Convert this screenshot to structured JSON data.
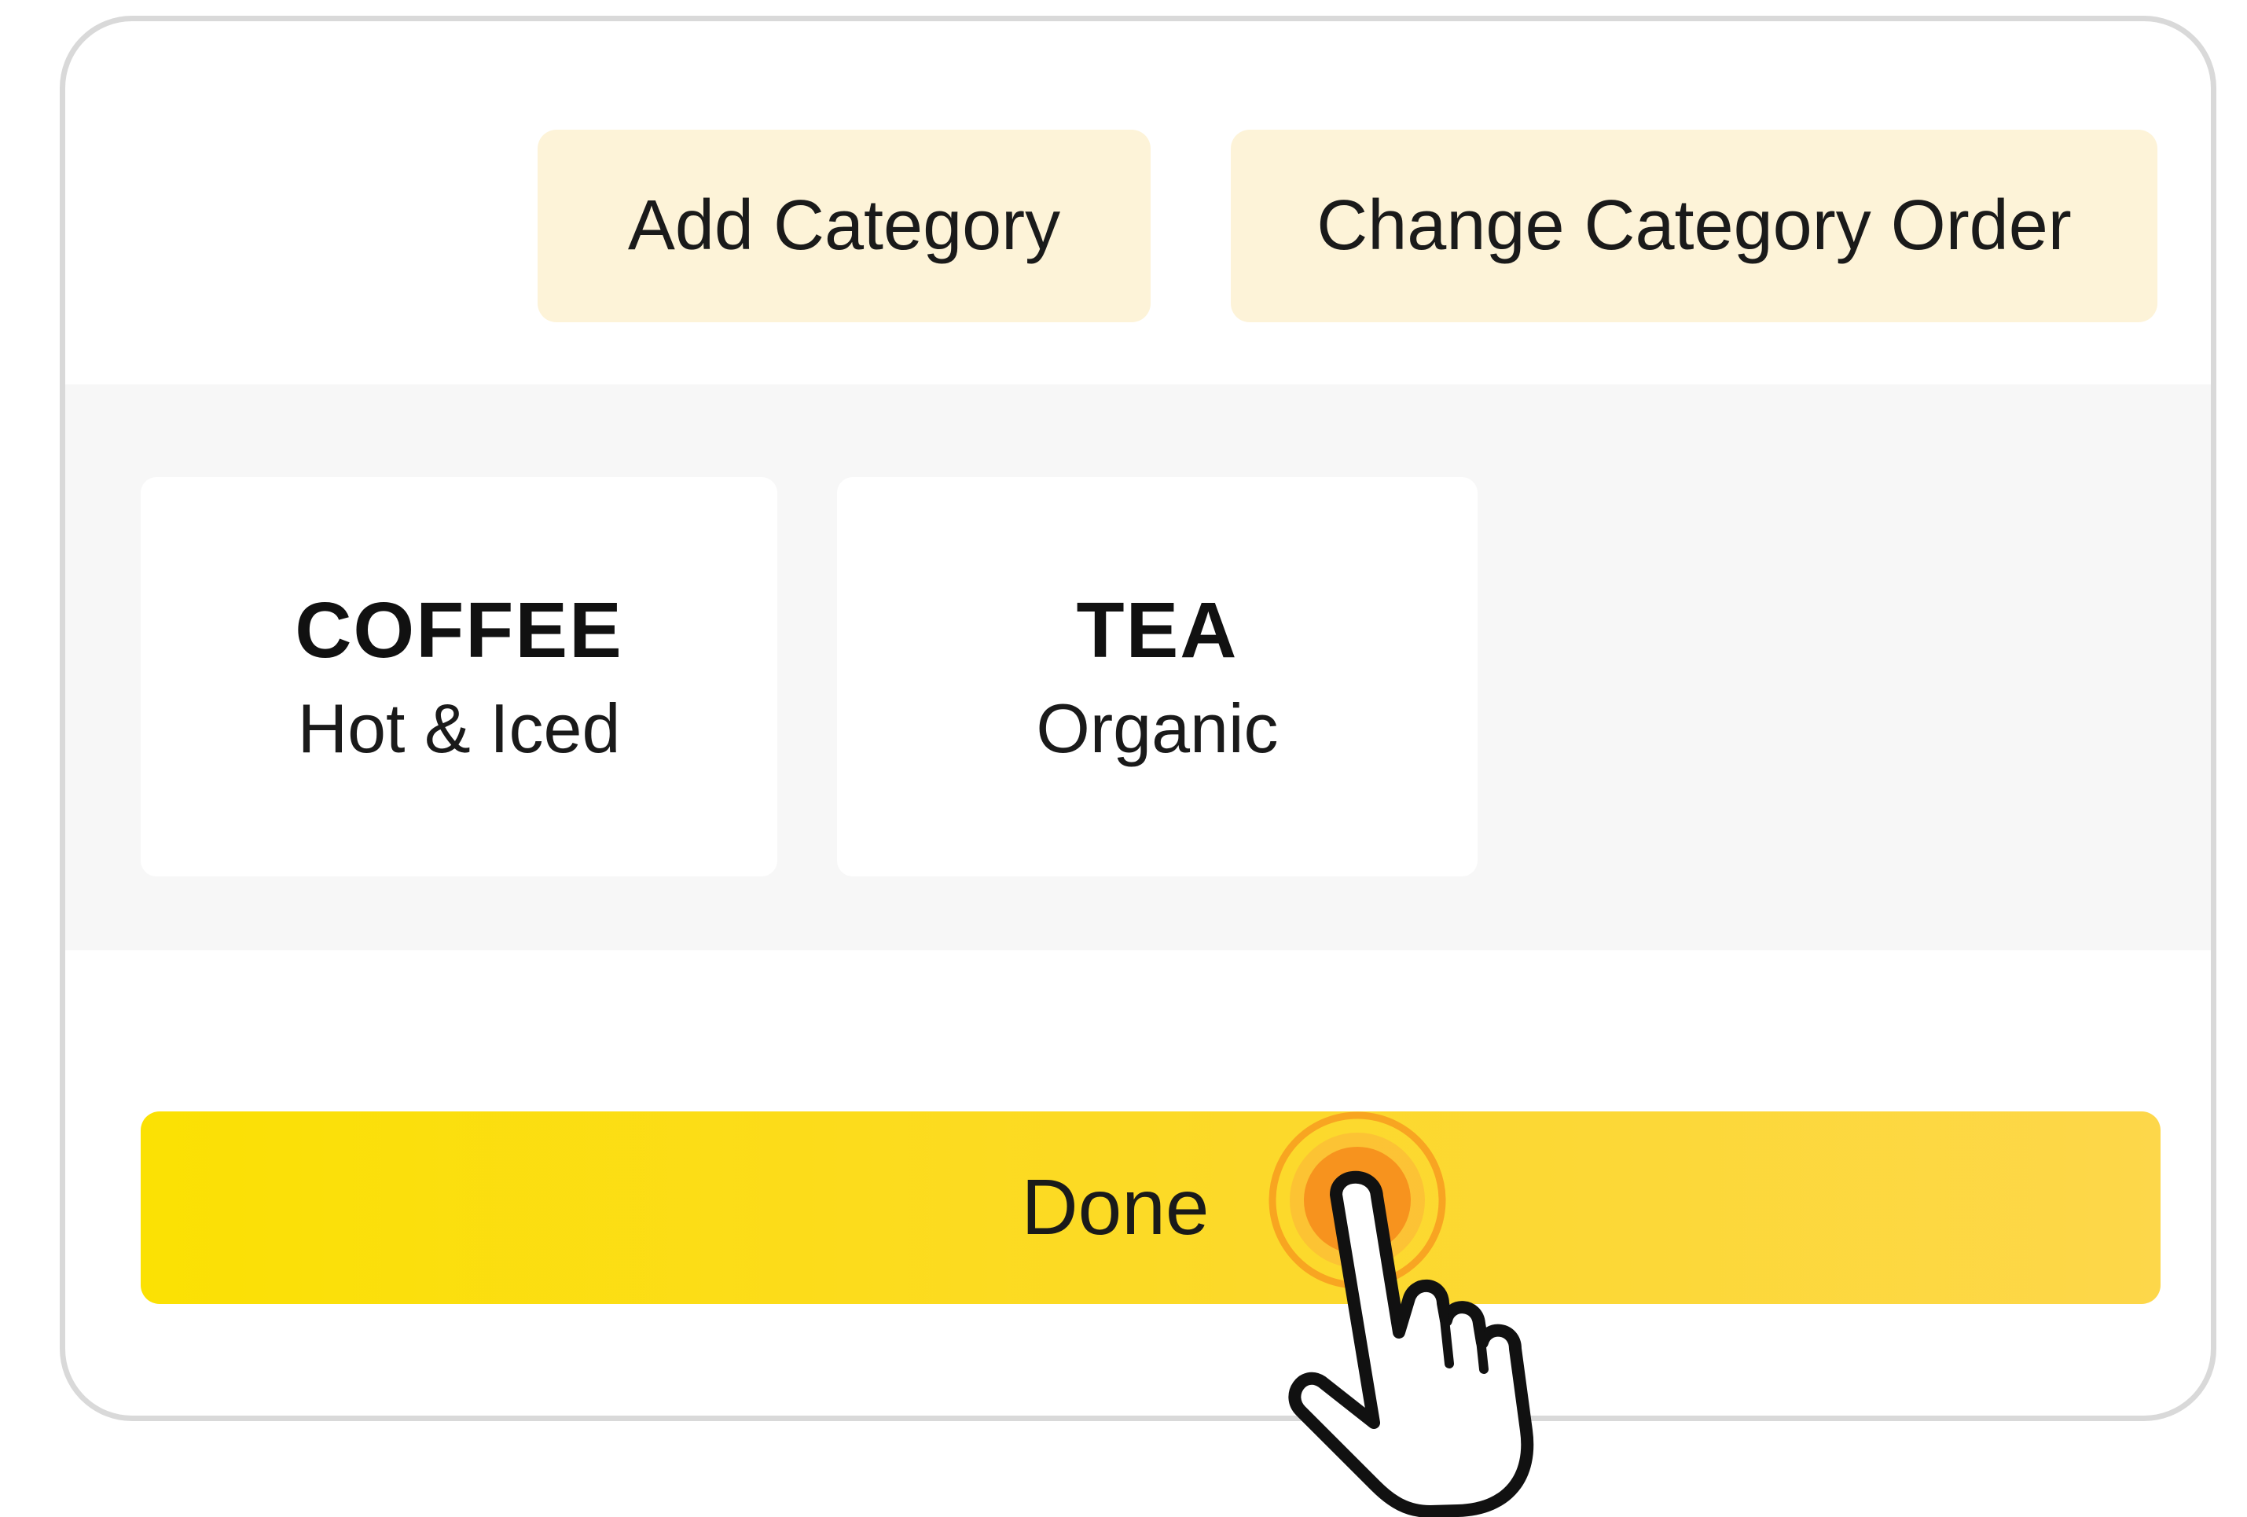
{
  "toolbar": {
    "add_category_label": "Add Category",
    "change_order_label": "Change Category Order"
  },
  "categories": [
    {
      "title": "COFFEE",
      "subtitle": "Hot & Iced"
    },
    {
      "title": "TEA",
      "subtitle": "Organic"
    }
  ],
  "footer": {
    "done_label": "Done"
  },
  "icons": {
    "pointer": "hand-pointer-icon",
    "tap": "tap-ripple-icon"
  },
  "colors": {
    "toolbar_button_bg": "#fdf3d8",
    "panel_bg": "#f7f7f7",
    "done_button_start": "#fbe103",
    "done_button_end": "#fdd74a",
    "tap_ripple": "#f7931e"
  }
}
